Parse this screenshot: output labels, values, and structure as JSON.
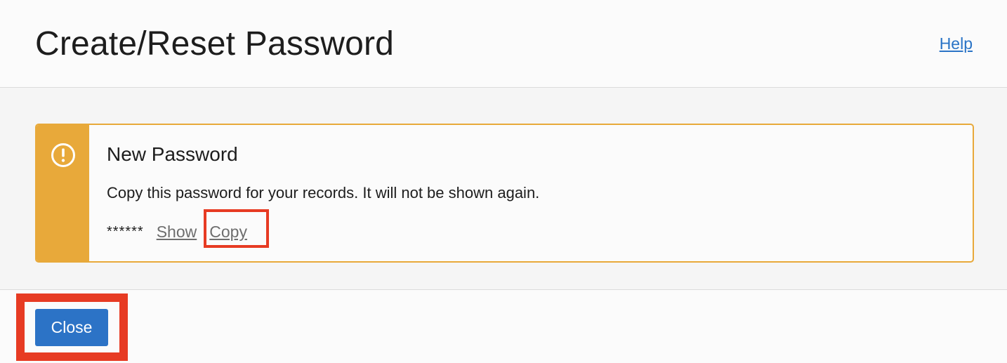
{
  "header": {
    "title": "Create/Reset Password",
    "help_label": "Help"
  },
  "alert": {
    "icon": "exclamation-circle-icon",
    "title": "New Password",
    "message": "Copy this password for your records. It will not be shown again.",
    "password_masked": "******",
    "show_label": "Show",
    "copy_label": "Copy"
  },
  "footer": {
    "close_label": "Close"
  },
  "colors": {
    "warning_accent": "#e8a93a",
    "primary_button": "#2c73c6",
    "link_blue": "#2a74c6",
    "highlight_red": "#e73b23"
  }
}
